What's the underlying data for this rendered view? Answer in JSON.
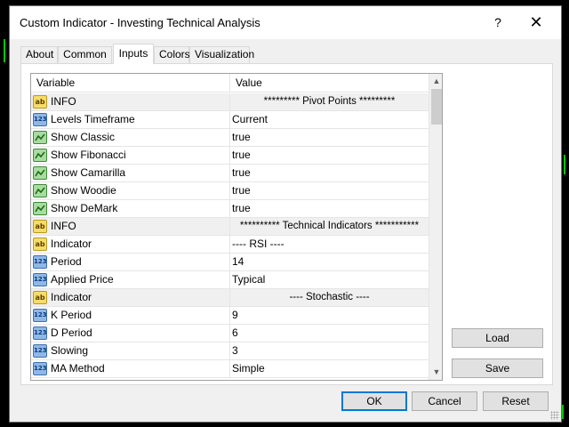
{
  "window": {
    "title": "Custom Indicator - Investing Technical Analysis",
    "help_label": "?",
    "close_label": "✕"
  },
  "tabs": [
    {
      "label": "About"
    },
    {
      "label": "Common"
    },
    {
      "label": "Inputs",
      "active": true
    },
    {
      "label": "Colors"
    },
    {
      "label": "Visualization"
    }
  ],
  "grid": {
    "headers": {
      "variable": "Variable",
      "value": "Value"
    },
    "rows": [
      {
        "variable": "INFO",
        "value": "********* Pivot Points *********",
        "type": "string",
        "info": true
      },
      {
        "variable": "Levels Timeframe",
        "value": "Current",
        "type": "number"
      },
      {
        "variable": "Show Classic",
        "value": "true",
        "type": "bool"
      },
      {
        "variable": "Show Fibonacci",
        "value": "true",
        "type": "bool"
      },
      {
        "variable": "Show Camarilla",
        "value": "true",
        "type": "bool"
      },
      {
        "variable": "Show Woodie",
        "value": "true",
        "type": "bool"
      },
      {
        "variable": "Show DeMark",
        "value": "true",
        "type": "bool"
      },
      {
        "variable": "INFO",
        "value": "********** Technical Indicators ***********",
        "type": "string",
        "info": true
      },
      {
        "variable": "Indicator",
        "value": "---- RSI ----",
        "type": "string"
      },
      {
        "variable": "Period",
        "value": "14",
        "type": "number"
      },
      {
        "variable": "Applied Price",
        "value": "Typical",
        "type": "number"
      },
      {
        "variable": "Indicator",
        "value": "---- Stochastic ----",
        "type": "string",
        "info": true
      },
      {
        "variable": "K Period",
        "value": "9",
        "type": "number"
      },
      {
        "variable": "D Period",
        "value": "6",
        "type": "number"
      },
      {
        "variable": "Slowing",
        "value": "3",
        "type": "number"
      },
      {
        "variable": "MA Method",
        "value": "Simple",
        "type": "number"
      }
    ]
  },
  "buttons": {
    "load": "Load",
    "save": "Save",
    "ok": "OK",
    "cancel": "Cancel",
    "reset": "Reset"
  },
  "icons": {
    "string": "ab",
    "number": "123",
    "bool": "chart-line-icon"
  }
}
